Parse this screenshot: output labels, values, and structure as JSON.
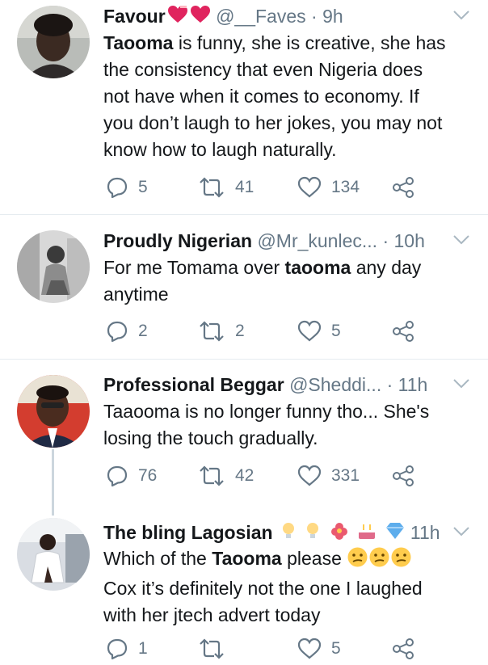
{
  "tweets": [
    {
      "name": "Favour",
      "handle": "@__Faves",
      "time": "· 9h",
      "lines": [
        [
          {
            "t": "Taooma",
            "b": true
          },
          {
            "t": " is funny, she is creative, she has"
          }
        ],
        [
          {
            "t": "the consistency that even Nigeria does"
          }
        ],
        [
          {
            "t": "not have when it comes to economy. If"
          }
        ],
        [
          {
            "t": "you don’t laugh to her jokes, you may not"
          }
        ],
        [
          {
            "t": "know how to laugh naturally."
          }
        ]
      ],
      "replies": "5",
      "retweets": "41",
      "likes": "134",
      "name_emoji": [
        "heart-icon",
        "heart-icon"
      ]
    },
    {
      "name": "Proudly Nigerian",
      "handle": "@Mr_kunlec...",
      "time": "· 10h",
      "lines": [
        [
          {
            "t": "For me Tomama over "
          },
          {
            "t": "taooma",
            "b": true
          },
          {
            "t": " any day"
          }
        ],
        [
          {
            "t": "anytime"
          }
        ]
      ],
      "replies": "2",
      "retweets": "2",
      "likes": "5"
    },
    {
      "name": "Professional Beggar",
      "handle": "@Sheddi...",
      "time": "· 11h",
      "lines": [
        [
          {
            "t": "Taaooma is no longer funny tho... She's"
          }
        ],
        [
          {
            "t": "losing the touch gradually."
          }
        ]
      ],
      "replies": "76",
      "retweets": "42",
      "likes": "331"
    },
    {
      "name": "The bling Lagosian",
      "handle": "",
      "time": "11h",
      "lines": [
        [
          {
            "t": "Which of the "
          },
          {
            "t": "Taooma",
            "b": true
          },
          {
            "t": " please "
          }
        ],
        [
          {
            "t": "Cox it’s definitely not the one I laughed"
          }
        ],
        [
          {
            "t": "with her jtech advert today"
          }
        ]
      ],
      "replies": "1",
      "retweets": "",
      "likes": "5",
      "name_emoji": [
        "bulb-icon",
        "bulb-icon",
        "flower-icon",
        "cake-icon",
        "gem-icon"
      ],
      "line_emoji": [
        "confused-face-icon",
        "confused-face-icon",
        "confused-face-icon"
      ]
    }
  ],
  "colors": {
    "text": "#14171a",
    "muted": "#657786",
    "divider": "#e6ecf0",
    "heart": "#e0245e"
  }
}
